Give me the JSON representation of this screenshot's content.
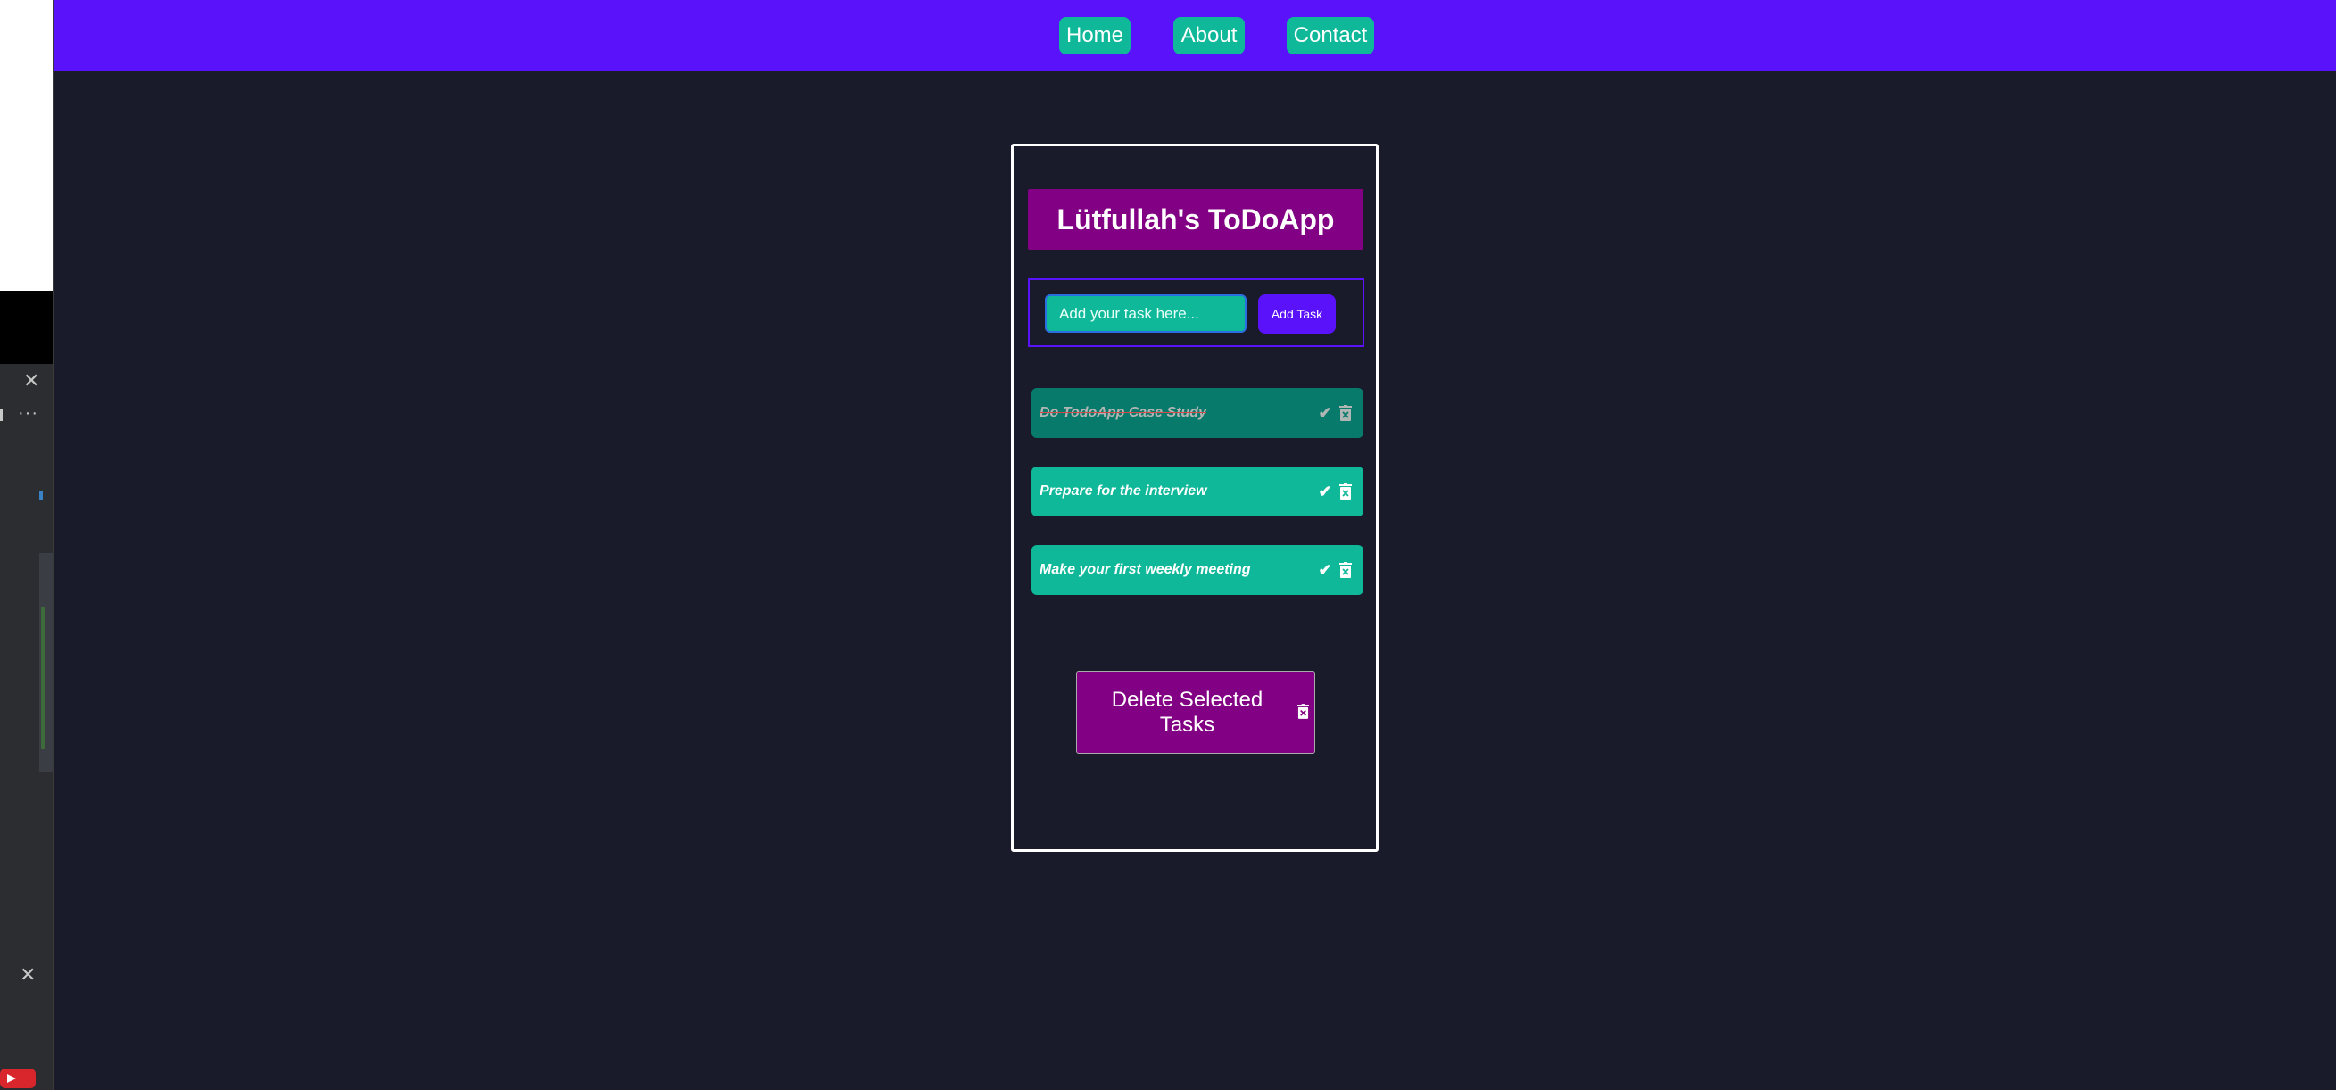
{
  "nav": {
    "home": "Home",
    "about": "About",
    "contact": "Contact"
  },
  "app": {
    "title": "Lütfullah's ToDoApp",
    "input_placeholder": "Add your task here...",
    "add_button": "Add Task",
    "tasks": [
      {
        "text": "Do TodoApp Case Study",
        "completed": true
      },
      {
        "text": "Prepare for the interview",
        "completed": false
      },
      {
        "text": "Make your first weekly meeting",
        "completed": false
      }
    ],
    "delete_selected_button": "Delete Selected Tasks"
  },
  "colors": {
    "navbar": "#5a12fa",
    "accent_teal": "#10b89a",
    "done_teal": "#087a6b",
    "title_purple": "#820083",
    "background": "#191b2a"
  },
  "icons": {
    "check": "check-icon",
    "trash": "trash-icon"
  }
}
